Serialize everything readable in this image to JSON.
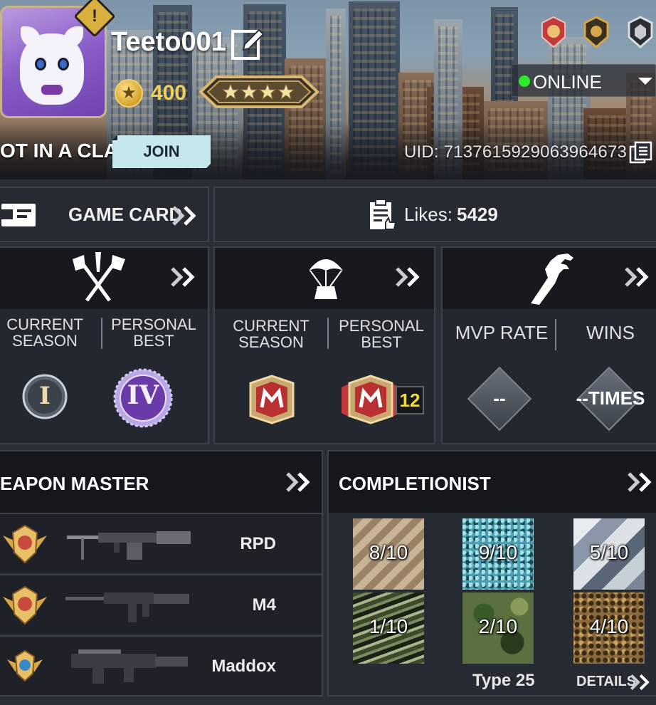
{
  "profile": {
    "name": "Teeto001",
    "currency": "400",
    "status": "ONLINE",
    "clan_status": "OT IN A CLAN",
    "join_label": "JOIN",
    "uid": "UID: 7137615929063964673",
    "warning_glyph": "!",
    "rank_stars": 4
  },
  "top_row": {
    "game_card_label": "GAME CARD",
    "likes_label": "Likes:",
    "likes_value": "5429"
  },
  "multiplayer": {
    "icon": "crossed-swords-icon",
    "col1": "CURRENT\nSEASON",
    "col2": "PERSONAL\nBEST",
    "current_rank": "I",
    "best_rank": "IV"
  },
  "battle_royale": {
    "icon": "parachute-crate-icon",
    "col1": "CURRENT\nSEASON",
    "col2": "PERSONAL\nBEST",
    "best_count": "12"
  },
  "zombies": {
    "icon": "zombie-hand-icon",
    "col1": "MVP RATE",
    "col2": "WINS",
    "mvp_value": "--",
    "wins_value": "--TIMES"
  },
  "weapon_master": {
    "title": "EAPON MASTER",
    "weapons": [
      {
        "name": "RPD"
      },
      {
        "name": "M4"
      },
      {
        "name": "Maddox"
      }
    ]
  },
  "completionist": {
    "title": "COMPLETIONIST",
    "camos": [
      {
        "value": "8/10",
        "pattern": "stripes"
      },
      {
        "value": "9/10",
        "pattern": "cyan-digital"
      },
      {
        "value": "5/10",
        "pattern": "arctic"
      },
      {
        "value": "1/10",
        "pattern": "tiger"
      },
      {
        "value": "2/10",
        "pattern": "woodland"
      },
      {
        "value": "4/10",
        "pattern": "desert-spots"
      }
    ],
    "caption": "Type 25",
    "details_label": "DETAILS"
  },
  "colors": {
    "accent_gold": "#f0d058",
    "online_green": "#2ee82a",
    "join_bg": "#c4e8ec"
  }
}
